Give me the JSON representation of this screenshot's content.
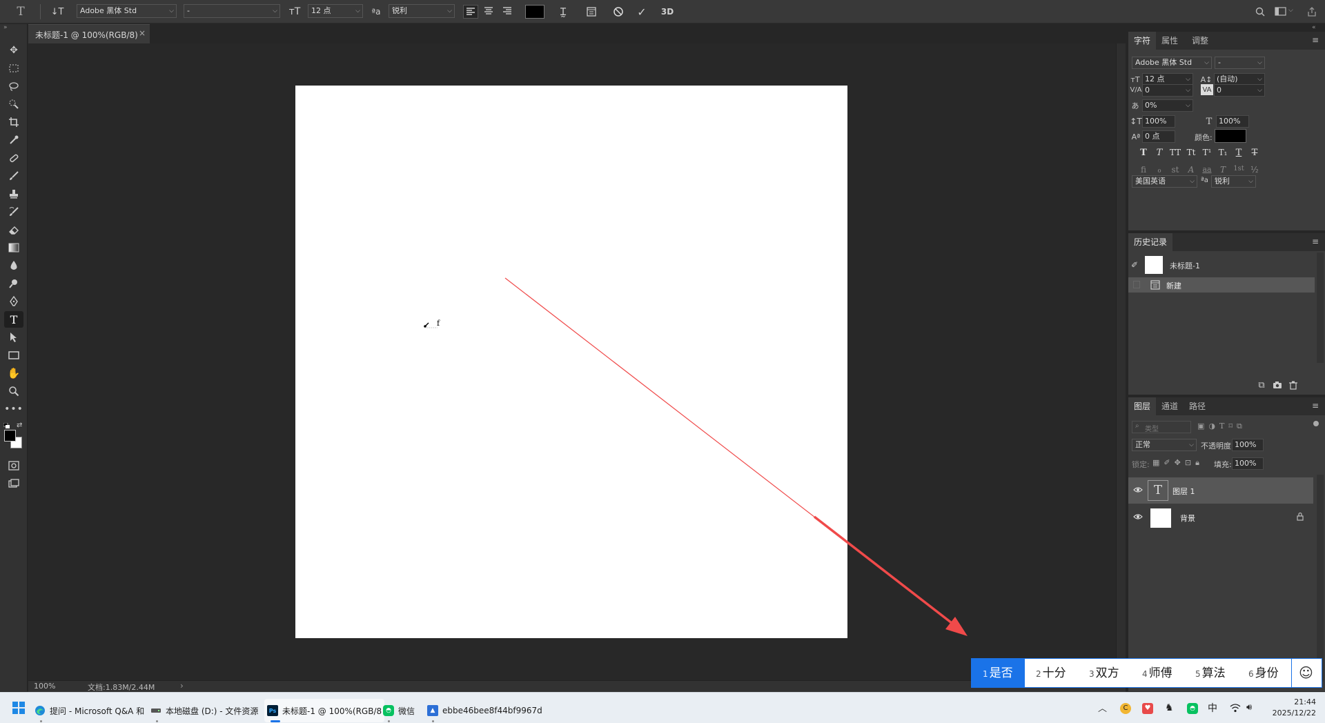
{
  "options_bar": {
    "font_family": "Adobe 黑体 Std",
    "font_style": "-",
    "font_size": "12 点",
    "antialias": "锐利",
    "text_color": "#000000",
    "three_d": "3D"
  },
  "document_tab": {
    "title": "未标题-1 @ 100%(RGB/8)",
    "close": "×"
  },
  "canvas": {
    "cursor_text": "f"
  },
  "status_bar": {
    "zoom": "100%",
    "doc_info": "文档:1.83M/2.44M",
    "arrow": "›"
  },
  "character_panel": {
    "tabs": [
      "字符",
      "属性",
      "调整"
    ],
    "font_family": "Adobe 黑体 Std",
    "font_style": "-",
    "size": "12 点",
    "leading": "(自动)",
    "kerning": "0",
    "tracking": "0",
    "tsume": "0%",
    "vscale": "100%",
    "hscale": "100%",
    "baseline": "0 点",
    "color_label": "颜色:",
    "color": "#000000",
    "style_buttons": [
      "T",
      "T",
      "TT",
      "Tt",
      "T¹",
      "T₁",
      "T",
      "T"
    ],
    "ot_buttons": [
      "fi",
      "ℴ",
      "st",
      "A",
      "aa",
      "T",
      "1st",
      "½"
    ],
    "language": "美国英语",
    "aa_label": "ªa",
    "antialias": "锐利"
  },
  "history_panel": {
    "title": "历史记录",
    "snapshot_label": "未标题-1",
    "items": [
      {
        "label": "新建"
      }
    ]
  },
  "layers_panel": {
    "tabs": [
      "图层",
      "通道",
      "路径"
    ],
    "filter_placeholder": "类型",
    "blend_mode": "正常",
    "opacity_label": "不透明度:",
    "opacity": "100%",
    "lock_label": "锁定:",
    "fill_label": "填充:",
    "fill": "100%",
    "layers": [
      {
        "name": "图层 1",
        "type": "text",
        "selected": true
      },
      {
        "name": "背景",
        "type": "background",
        "locked": true
      }
    ]
  },
  "ime": {
    "candidates": [
      {
        "n": "1",
        "text": "是否"
      },
      {
        "n": "2",
        "text": "十分"
      },
      {
        "n": "3",
        "text": "双方"
      },
      {
        "n": "4",
        "text": "师傅"
      },
      {
        "n": "5",
        "text": "算法"
      },
      {
        "n": "6",
        "text": "身份"
      }
    ],
    "emoji": "☺"
  },
  "taskbar": {
    "items": [
      {
        "label": "提问 - Microsoft Q&A 和"
      },
      {
        "label": "本地磁盘 (D:) - 文件资源"
      },
      {
        "label": "未标题-1 @ 100%(RGB/8"
      },
      {
        "label": "微信"
      },
      {
        "label": "ebbe46bee8f44bf9967d"
      }
    ],
    "tray_lang": "中",
    "time": "21:44",
    "date": "2025/12/22"
  },
  "colors": {
    "accent": "#1a73e8",
    "annotation": "#f04a4a"
  }
}
